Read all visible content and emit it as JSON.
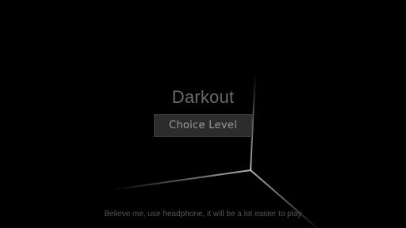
{
  "game": {
    "title": "Darkout",
    "choice_level_label": "Choice Level",
    "hint": "Believe me, use headphone, it will be a lot easier to play"
  },
  "colors": {
    "background": "#000000",
    "title": "#6a6a6a",
    "button_bg": "#2c2c2c",
    "button_text": "#9a9a9a",
    "hint": "#565656",
    "edge_lines": "#cfcfcf"
  }
}
